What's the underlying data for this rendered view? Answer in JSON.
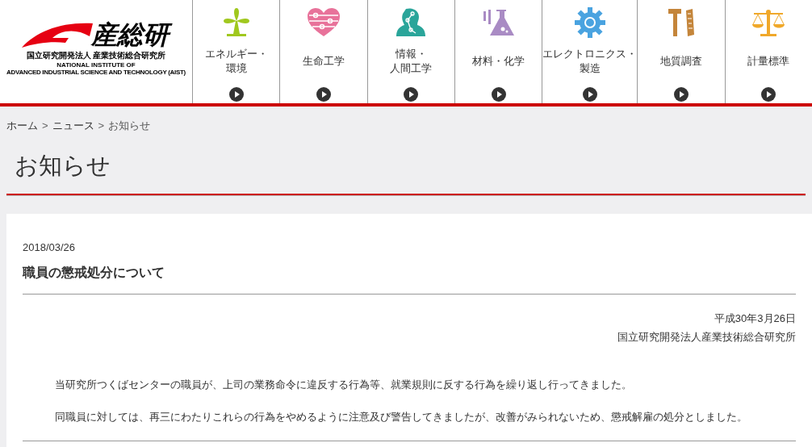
{
  "logo": {
    "mark": "産総研",
    "name_ja": "国立研究開発法人 産業技術総合研究所",
    "name_en_1": "NATIONAL INSTITUTE OF",
    "name_en_2": "ADVANCED INDUSTRIAL SCIENCE AND TECHNOLOGY (AIST)"
  },
  "nav": [
    {
      "lines": [
        "エネルギー・",
        "環境"
      ]
    },
    {
      "lines": [
        "生命工学"
      ]
    },
    {
      "lines": [
        "情報・",
        "人間工学"
      ]
    },
    {
      "lines": [
        "材料・化学"
      ]
    },
    {
      "lines": [
        "エレクトロニクス・",
        "製造"
      ]
    },
    {
      "lines": [
        "地質調査"
      ]
    },
    {
      "lines": [
        "計量標準"
      ]
    }
  ],
  "breadcrumb": [
    {
      "kind": "link",
      "label": "ホーム"
    },
    {
      "kind": "separator",
      "label": ">"
    },
    {
      "kind": "link",
      "label": "ニュース"
    },
    {
      "kind": "separator",
      "label": ">"
    },
    {
      "kind": "current",
      "label": "お知らせ"
    }
  ],
  "page_title": "お知らせ",
  "article": {
    "date": "2018/03/26",
    "title": "職員の懲戒処分について",
    "issued_date": "平成30年3月26日",
    "issuer": "国立研究開発法人産業技術総合研究所",
    "paragraphs": [
      "当研究所つくばセンターの職員が、上司の業務命令に違反する行為等、就業規則に反する行為を繰り返し行ってきました。",
      "同職員に対しては、再三にわたりこれらの行為をやめるように注意及び警告してきましたが、改善がみられないため、懲戒解雇の処分としました。"
    ]
  }
}
